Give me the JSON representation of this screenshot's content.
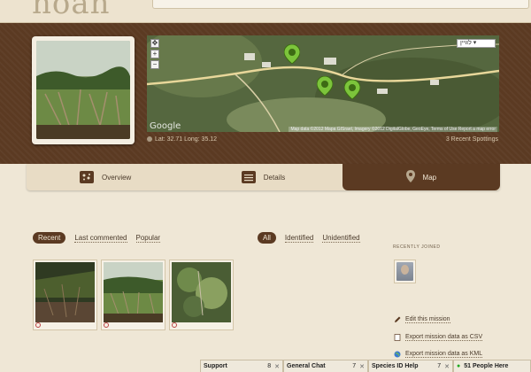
{
  "header": {
    "logo_text": "noah"
  },
  "banner": {
    "coords_text": "Lat: 32.71 Long: 35.12",
    "spottings_text": "3 Recent Spottings",
    "map": {
      "dropdown_label": "לוויין",
      "google_text": "Google",
      "credits_text": "Map data ©2012 Mapa GISrael, Imagery ©2012 DigitalGlobe, GeoEye, Terms of Use  Report a map error"
    }
  },
  "tabs": [
    {
      "label": "Overview",
      "icon": "photos-icon"
    },
    {
      "label": "Details",
      "icon": "list-icon"
    },
    {
      "label": "Map",
      "icon": "map-pin-icon",
      "active": true
    }
  ],
  "filters_left": {
    "active": "Recent",
    "links": [
      "Last commented",
      "Popular"
    ]
  },
  "filters_right": {
    "active": "All",
    "links": [
      "Identified",
      "Unidentified"
    ]
  },
  "recently_joined": "RECENTLY JOINED",
  "actions": [
    {
      "label": "Edit this mission",
      "icon": "pencil-icon"
    },
    {
      "label": "Export mission data as CSV",
      "icon": "document-icon"
    },
    {
      "label": "Export mission data as KML",
      "icon": "globe-icon"
    }
  ],
  "chat_tabs": [
    {
      "label": "Support",
      "count": "8"
    },
    {
      "label": "General Chat",
      "count": "7"
    },
    {
      "label": "Species ID Help",
      "count": "7"
    }
  ],
  "people_here": "51 People Here",
  "colors": {
    "brown": "#5b3a22",
    "paper": "#efe7d6",
    "pin_green": "#7cc43b"
  }
}
